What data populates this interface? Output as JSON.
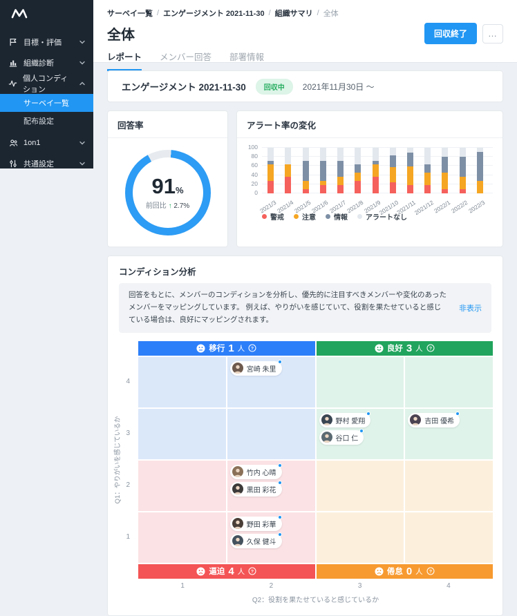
{
  "sidebar": {
    "logo": "M",
    "items": [
      {
        "label": "目標・評価",
        "icon": "flag-icon"
      },
      {
        "label": "組織診断",
        "icon": "bar-chart-icon"
      },
      {
        "label": "個人コンディション",
        "icon": "pulse-icon",
        "expanded": true,
        "children": [
          {
            "label": "サーベイ一覧",
            "active": true
          },
          {
            "label": "配布設定",
            "active": false
          }
        ]
      },
      {
        "label": "1on1",
        "icon": "people-icon"
      },
      {
        "label": "共通設定",
        "icon": "sliders-icon"
      }
    ]
  },
  "breadcrumb": {
    "items": [
      "サーベイ一覧",
      "エンゲージメント 2021-11-30",
      "組織サマリ",
      "全体"
    ],
    "separator": "/"
  },
  "header": {
    "title": "全体",
    "end_button": "回収終了",
    "more_button": "…"
  },
  "tabs": [
    {
      "label": "レポート",
      "active": true
    },
    {
      "label": "メンバー回答",
      "active": false
    },
    {
      "label": "部署情報",
      "active": false
    }
  ],
  "survey_info": {
    "name": "エンゲージメント 2021-11-30",
    "status_badge": "回収中",
    "period": "2021年11月30日 ～"
  },
  "chart_data": [
    {
      "type": "donut",
      "title": "回答率",
      "value": "91",
      "unit": "%",
      "percent": 91,
      "delta_label": "前回比",
      "delta_arrow": "↑",
      "delta_value": "2.7%",
      "ring_color": "#2D9CF4",
      "rest_color": "#E7EBEF"
    },
    {
      "type": "bar",
      "stacked": true,
      "title": "アラート率の変化",
      "categories": [
        "2021/3",
        "2021/4",
        "2021/5",
        "2021/6",
        "2021/7",
        "2021/8",
        "2021/9",
        "2021/10",
        "2021/11",
        "2021/12",
        "2022/1",
        "2022/2",
        "2022/3"
      ],
      "series": [
        {
          "name": "警戒",
          "color": "#F5615C",
          "values": [
            27,
            36,
            9,
            18,
            18,
            27,
            36,
            25,
            18,
            18,
            9,
            9,
            0
          ]
        },
        {
          "name": "注意",
          "color": "#F5A623",
          "values": [
            36,
            27,
            18,
            9,
            18,
            18,
            27,
            33,
            41,
            27,
            36,
            27,
            27
          ]
        },
        {
          "name": "情報",
          "color": "#7D8FA5",
          "values": [
            9,
            0,
            45,
            45,
            36,
            18,
            9,
            25,
            30,
            18,
            36,
            45,
            64
          ]
        },
        {
          "name": "アラートなし",
          "color": "#E3E8EE",
          "values": [
            28,
            37,
            28,
            28,
            28,
            37,
            28,
            17,
            11,
            37,
            19,
            19,
            9
          ]
        }
      ],
      "ylim": [
        0,
        100
      ],
      "yticks": [
        0,
        20,
        40,
        60,
        80,
        100
      ],
      "legend_position": "bottom",
      "grid": true
    }
  ],
  "condition_card": {
    "title": "コンディション分析",
    "description": "回答をもとに、メンバーのコンディションを分析し、優先的に注目すべきメンバーや変化のあったメンバーをマッピングしています。 例えば、やりがいを感じていて、役割を果たせていると感じている場合は、良好にマッピングされます。",
    "hide_link": "非表示"
  },
  "condition_map": {
    "quadrants": [
      {
        "key": "top-left",
        "label": "移行",
        "count": "1",
        "unit": "人",
        "color": "#2D7FF9",
        "mouth": "neutral"
      },
      {
        "key": "top-right",
        "label": "良好",
        "count": "3",
        "unit": "人",
        "color": "#21A45D",
        "mouth": "smile"
      },
      {
        "key": "bottom-left",
        "label": "逼迫",
        "count": "4",
        "unit": "人",
        "color": "#F45455",
        "mouth": "frown"
      },
      {
        "key": "bottom-right",
        "label": "倦怠",
        "count": "0",
        "unit": "人",
        "color": "#F79A30",
        "mouth": "frown"
      }
    ],
    "members": [
      {
        "name": "宮崎 朱里",
        "row": 4,
        "col": 2,
        "avatar_color": "#6e5a4e"
      },
      {
        "name": "野村 愛翔",
        "row": 3,
        "col": 3,
        "avatar_color": "#3a4652"
      },
      {
        "name": "谷口 仁",
        "row": 3,
        "col": 3,
        "avatar_color": "#5b6a72"
      },
      {
        "name": "吉田 優希",
        "row": 3,
        "col": 4,
        "avatar_color": "#4a4250"
      },
      {
        "name": "竹内 心晴",
        "row": 2,
        "col": 2,
        "avatar_color": "#8a7158"
      },
      {
        "name": "黒田 彩花",
        "row": 2,
        "col": 2,
        "avatar_color": "#3d3a3a"
      },
      {
        "name": "野田 彩華",
        "row": 1,
        "col": 2,
        "avatar_color": "#4a3f38"
      },
      {
        "name": "久保 健斗",
        "row": 1,
        "col": 2,
        "avatar_color": "#44525e"
      }
    ],
    "y_axis": {
      "label": "Q1：やりがいを感じているか",
      "ticks": [
        "4",
        "3",
        "2",
        "1"
      ]
    },
    "x_axis": {
      "label": "Q2：役割を果たせていると感じているか",
      "ticks": [
        "1",
        "2",
        "3",
        "4"
      ]
    }
  },
  "colors": {
    "accent_blue": "#2196F3",
    "sidebar_bg": "#1C2631",
    "badge_green": "#27AE60",
    "cell_top_left": "#DBE8FA",
    "cell_top_right": "#E0F3EA",
    "cell_bottom_left": "#FBE2E4",
    "cell_bottom_right": "#FCF0DD"
  }
}
